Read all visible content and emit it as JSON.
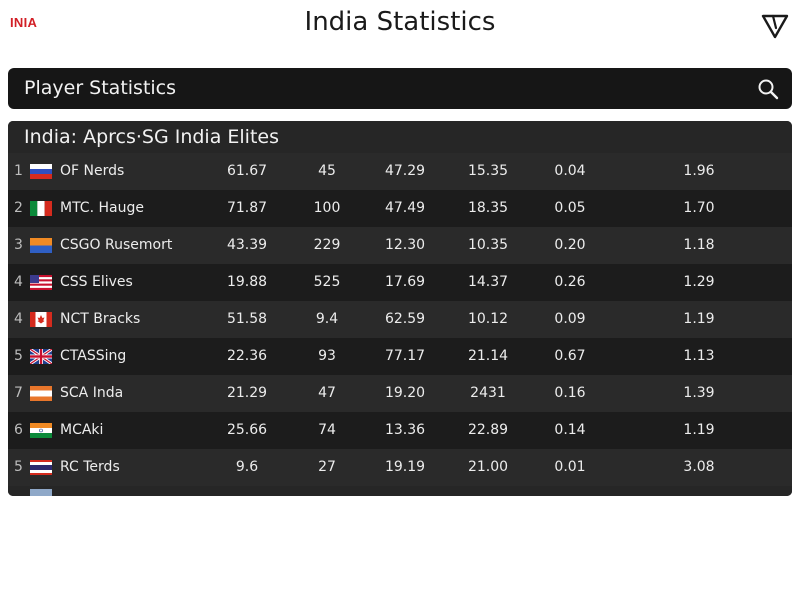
{
  "header": {
    "logo_text": "INIA",
    "title": "India Statistics",
    "menu_icon": "triangle-down-icon"
  },
  "search": {
    "label": "Player Statistics",
    "icon": "search-icon"
  },
  "panel": {
    "title": "India: Aprcs·SG India Elites"
  },
  "rows": [
    {
      "rank": "1",
      "flag": "russia-flag-icon",
      "name": "OF Nerds",
      "v1": "61.67",
      "v2": "45",
      "v3": "47.29",
      "v4": "15.35",
      "v5": "0.04",
      "v6": "1.96"
    },
    {
      "rank": "2",
      "flag": "italy-flag-icon",
      "name": "MTC. Hauge",
      "v1": "71.87",
      "v2": "100",
      "v3": "47.49",
      "v4": "18.35",
      "v5": "0.05",
      "v6": "1.70"
    },
    {
      "rank": "3",
      "flag": "orange-blue-flag-icon",
      "name": "CSGO Rusemort",
      "v1": "43.39",
      "v2": "229",
      "v3": "12.30",
      "v4": "10.35",
      "v5": "0.20",
      "v6": "1.18"
    },
    {
      "rank": "4",
      "flag": "usa-flag-icon",
      "name": "CSS Elives",
      "v1": "19.88",
      "v2": "525",
      "v3": "17.69",
      "v4": "14.37",
      "v5": "0.26",
      "v6": "1.29"
    },
    {
      "rank": "4",
      "flag": "canada-flag-icon",
      "name": "NCT Bracks",
      "v1": "51.58",
      "v2": "9.4",
      "v3": "62.59",
      "v4": "10.12",
      "v5": "0.09",
      "v6": "1.19"
    },
    {
      "rank": "5",
      "flag": "uk-flag-icon",
      "name": "CTASSing",
      "v1": "22.36",
      "v2": "93",
      "v3": "77.17",
      "v4": "21.14",
      "v5": "0.67",
      "v6": "1.13"
    },
    {
      "rank": "7",
      "flag": "orange-white-flag-icon",
      "name": "SCA Inda",
      "v1": "21.29",
      "v2": "47",
      "v3": "19.20",
      "v4": "2431",
      "v5": "0.16",
      "v6": "1.39"
    },
    {
      "rank": "6",
      "flag": "india-flag-icon",
      "name": "MCAki",
      "v1": "25.66",
      "v2": "74",
      "v3": "13.36",
      "v4": "22.89",
      "v5": "0.14",
      "v6": "1.19"
    },
    {
      "rank": "5",
      "flag": "thailand-flag-icon",
      "name": "RC Terds",
      "v1": "9.6",
      "v2": "27",
      "v3": "19.19",
      "v4": "21.00",
      "v5": "0.01",
      "v6": "3.08"
    }
  ],
  "colors": {
    "logo": "#d21f26",
    "panel_background": "#1e1e1e",
    "row_light": "#2a2a2a",
    "row_dark": "#1c1c1c"
  }
}
